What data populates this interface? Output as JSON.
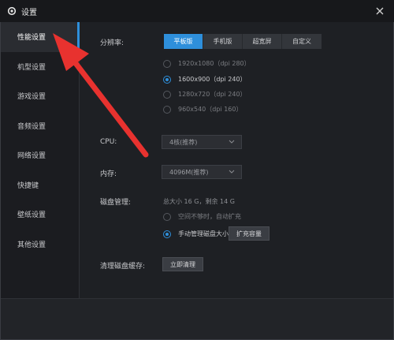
{
  "window": {
    "title": "设置"
  },
  "sidebar": {
    "items": [
      {
        "label": "性能设置",
        "active": true
      },
      {
        "label": "机型设置"
      },
      {
        "label": "游戏设置"
      },
      {
        "label": "音频设置"
      },
      {
        "label": "网络设置"
      },
      {
        "label": "快捷键"
      },
      {
        "label": "壁纸设置"
      },
      {
        "label": "其他设置"
      }
    ]
  },
  "resolution": {
    "label": "分辨率:",
    "tabs": [
      "平板版",
      "手机版",
      "超宽屏",
      "自定义"
    ],
    "selected_tab": "平板版",
    "options": [
      "1920x1080（dpi 280）",
      "1600x900（dpi 240）",
      "1280x720（dpi 240）",
      "960x540（dpi 160）"
    ],
    "selected_option": "1600x900（dpi 240）"
  },
  "cpu": {
    "label": "CPU:",
    "value": "4核(推荐)"
  },
  "memory": {
    "label": "内存:",
    "value": "4096M(推荐)"
  },
  "disk": {
    "label": "磁盘管理:",
    "info": "总大小 16 G，剩余 14 G",
    "option_auto": "空间不够时，自动扩充",
    "option_manual": "手动管理磁盘大小",
    "expand_button": "扩充容量",
    "selected": "manual"
  },
  "cache": {
    "label": "清理磁盘缓存:",
    "button": "立即清理"
  },
  "colors": {
    "accent": "#2e8fdb",
    "arrow": "#e8322f",
    "background": "#1e2024"
  }
}
